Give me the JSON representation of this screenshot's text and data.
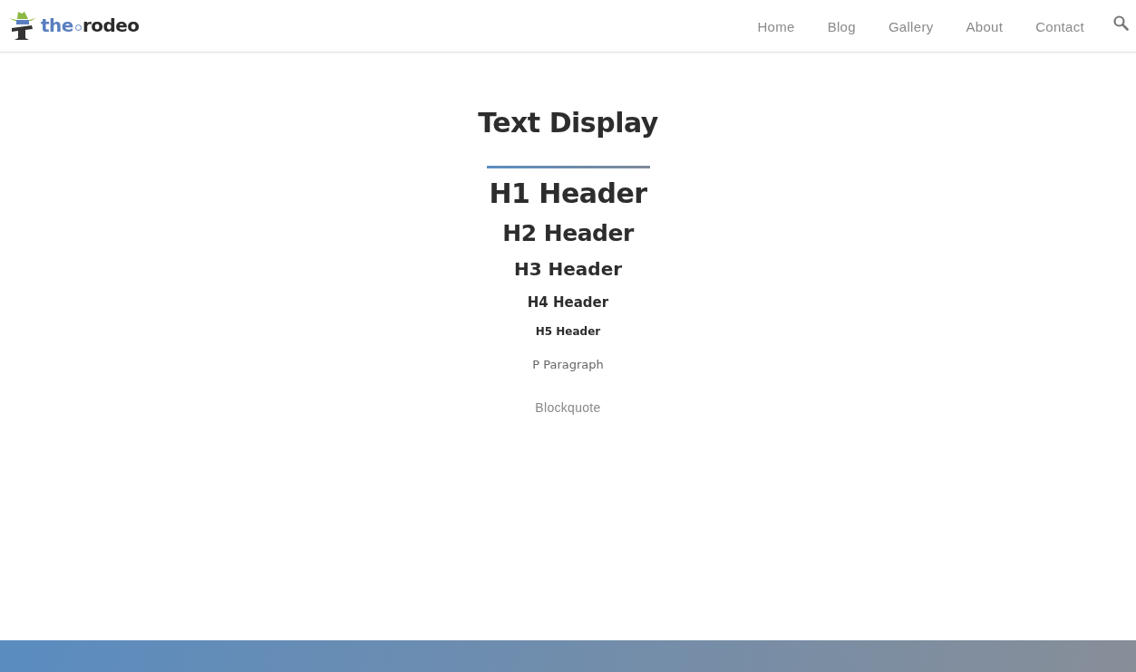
{
  "logo": {
    "first": "the",
    "second": "rodeo"
  },
  "nav": [
    "Home",
    "Blog",
    "Gallery",
    "About",
    "Contact"
  ],
  "title": "Text Display",
  "headers": [
    {
      "kind": "h1",
      "text": "H1 Header"
    },
    {
      "kind": "h2",
      "text": "H2 Header"
    },
    {
      "kind": "h3",
      "text": "H3 Header"
    },
    {
      "kind": "h4",
      "text": "H4 Header"
    },
    {
      "kind": "h5",
      "text": "H5 Header"
    },
    {
      "kind": "p",
      "text": "P Paragraph"
    },
    {
      "kind": "blockquote",
      "text": "Blockquote"
    }
  ]
}
